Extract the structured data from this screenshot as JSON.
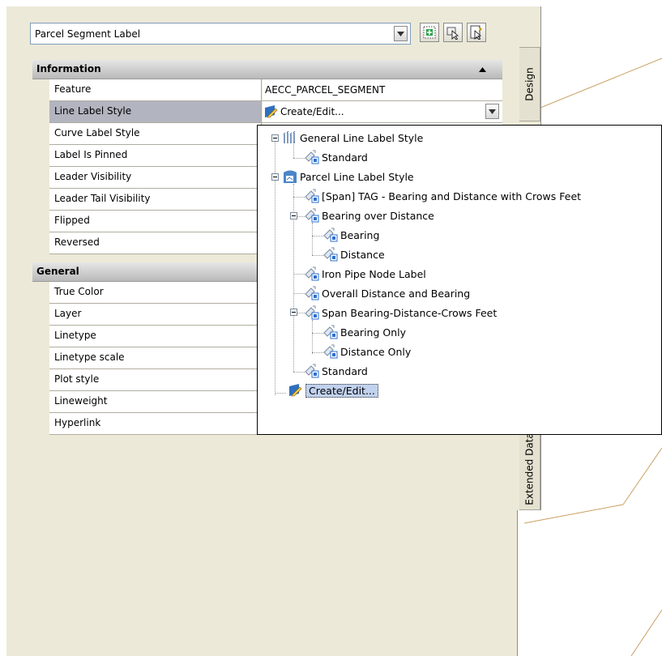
{
  "selector": {
    "value": "Parcel Segment Label"
  },
  "side_tabs": {
    "design": "Design",
    "extended": "Extended Data"
  },
  "categories": {
    "information": "Information",
    "general": "General"
  },
  "information_rows": [
    {
      "label": "Feature",
      "value": "AECC_PARCEL_SEGMENT"
    },
    {
      "label": "Line Label Style",
      "value": "Create/Edit..."
    },
    {
      "label": "Curve Label Style",
      "value": ""
    },
    {
      "label": "Label Is Pinned",
      "value": ""
    },
    {
      "label": "Leader Visibility",
      "value": ""
    },
    {
      "label": "Leader Tail Visibility",
      "value": ""
    },
    {
      "label": "Flipped",
      "value": ""
    },
    {
      "label": "Reversed",
      "value": ""
    }
  ],
  "general_rows": [
    {
      "label": "True Color"
    },
    {
      "label": "Layer"
    },
    {
      "label": "Linetype"
    },
    {
      "label": "Linetype scale"
    },
    {
      "label": "Plot style"
    },
    {
      "label": "Lineweight"
    },
    {
      "label": "Hyperlink"
    }
  ],
  "dropdown_tree": [
    "General Line Label Style",
    "Standard",
    "Parcel Line Label Style",
    "[Span] TAG - Bearing and Distance with Crows Feet",
    "Bearing over Distance",
    "Bearing",
    "Distance",
    "Iron Pipe Node Label",
    "Overall Distance and Bearing",
    "Span Bearing-Distance-Crows Feet",
    "Bearing Only",
    "Distance Only",
    "Standard",
    "Create/Edit..."
  ],
  "icons": {
    "selector_arrow": "chevron-down-icon",
    "add_button": "add-selection-icon",
    "select_objects": "select-objects-icon",
    "quick_select": "quick-select-icon",
    "style_icon": "label-style-icon",
    "edit_icon": "create-edit-icon"
  },
  "colors": {
    "drawing_lines": "#c8a060",
    "selection": "#b2b4bf",
    "panel": "#ece9d8"
  }
}
